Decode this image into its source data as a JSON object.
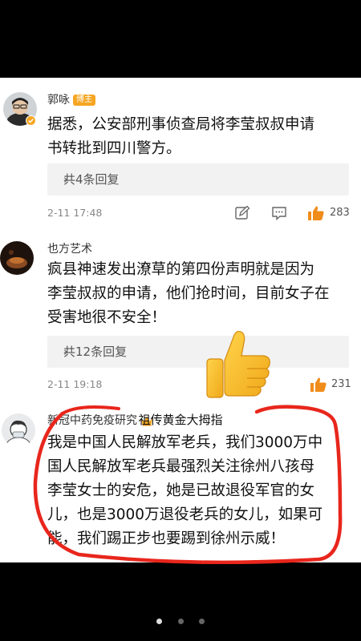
{
  "comments": [
    {
      "username": "郭咏",
      "badge": "博主",
      "text_lines": [
        "据悉，公安部刑事侦查局将李莹叔叔申请",
        "书转批到四川警方。"
      ],
      "replies": "共4条回复",
      "time": "2-11 17:48",
      "likes": "283"
    },
    {
      "username": "也方艺术",
      "text_lines": [
        "疯县神速发出潦草的第四份声明就是因为",
        "李莹叔叔的申请，他们抢时间，目前女子在",
        "受害地很不安全！"
      ],
      "replies": "共12条回复",
      "time": "2-11 19:18",
      "likes": "231"
    },
    {
      "username": "新冠中药免疫研究",
      "text_lines": [
        "我是中国人民解放军老兵，我们3000万中",
        "国人民解放军老兵最强烈关注徐州八孩母",
        "李莹女士的安危，她是已故退役军官的女",
        "儿，也是3000万退役老兵的女儿，如果可",
        "能，我们踢正步也要踢到徐州示威！"
      ]
    }
  ],
  "overlay_caption": "祖传黄金大拇指",
  "pager": {
    "count": 3,
    "active": 0
  },
  "colors": {
    "accent_orange": "#f5a623",
    "annotation_red": "#e8261c"
  }
}
